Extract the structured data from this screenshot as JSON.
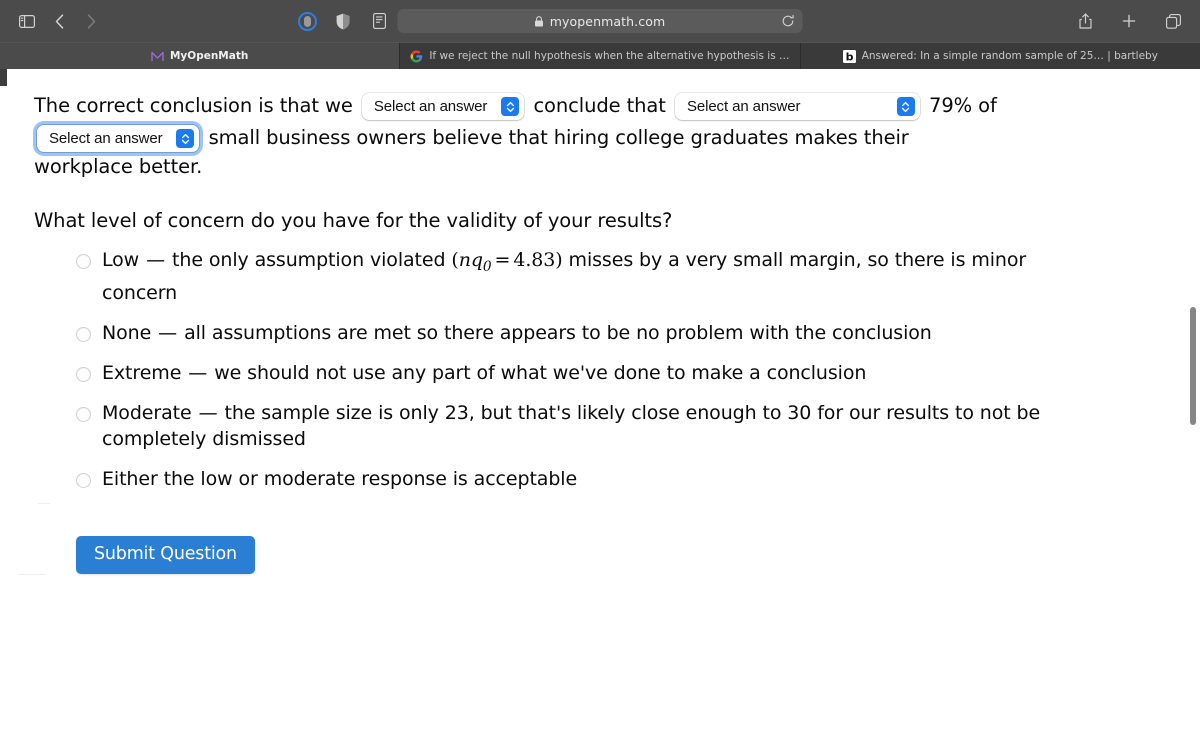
{
  "browser": {
    "url": "myopenmath.com",
    "url_secure_icon": "lock-icon",
    "toolbar_icons": {
      "sidebar": "sidebar-toggle-icon",
      "back": "back-arrow-icon",
      "forward": "forward-arrow-icon",
      "tab_group": "tab-group-icon",
      "privacy": "privacy-shield-icon",
      "reader": "reader-mode-icon",
      "reload": "reload-icon",
      "share": "share-icon",
      "new_tab": "plus-icon",
      "tab_overview": "tab-overview-icon"
    },
    "tabs": [
      {
        "title": "MyOpenMath",
        "favicon": "myopenmath-icon",
        "active": true
      },
      {
        "title": "If we reject the null hypothesis when the alternative hypothesis is true, we hav…",
        "favicon": "google-icon",
        "active": false
      },
      {
        "title": "Answered: In a simple random sample of 25… | bartleby",
        "favicon": "bartleby-icon",
        "active": false
      }
    ]
  },
  "question": {
    "sentence": {
      "part1": "The correct conclusion is that we",
      "part2": "conclude that",
      "part3": "79% of",
      "part4": "small business owners believe that hiring college graduates makes their workplace better."
    },
    "selects": [
      {
        "name": "conclusion-verb-select",
        "value": "Select an answer",
        "focused": false
      },
      {
        "name": "comparison-select",
        "value": "Select an answer",
        "focused": false
      },
      {
        "name": "direction-select",
        "value": "Select an answer",
        "focused": true
      }
    ],
    "prompt": "What level of concern do you have for the validity of your results?",
    "options": [
      {
        "label": "Low",
        "dash": "—",
        "text_before_math": "the only assumption violated",
        "math": {
          "open": "(",
          "var": "nq",
          "sub": "0",
          "op": "=",
          "value": "4.83",
          "close": ")"
        },
        "text_after_math": "misses by a very small margin, so there is minor concern",
        "selected": false
      },
      {
        "label": "None",
        "dash": "—",
        "text_before_math": "all assumptions are met so there appears to be no problem with the conclusion",
        "selected": false
      },
      {
        "label": "Extreme",
        "dash": "—",
        "text_before_math": "we should not use any part of what we've done to make a conclusion",
        "selected": false
      },
      {
        "label": "Moderate",
        "dash": "—",
        "text_before_math": "the sample size is only 23, but that's likely close enough to 30 for our results to not be completely dismissed",
        "selected": false
      },
      {
        "label": "Either the low or moderate response is acceptable",
        "dash": "",
        "text_before_math": "",
        "selected": false
      }
    ],
    "submit_label": "Submit Question"
  },
  "colors": {
    "accent_blue": "#2a7fd4",
    "stepper_blue": "#1a7bf0",
    "chrome_gray": "#4b4b4b",
    "tabstrip_gray": "#3a3a3a"
  }
}
